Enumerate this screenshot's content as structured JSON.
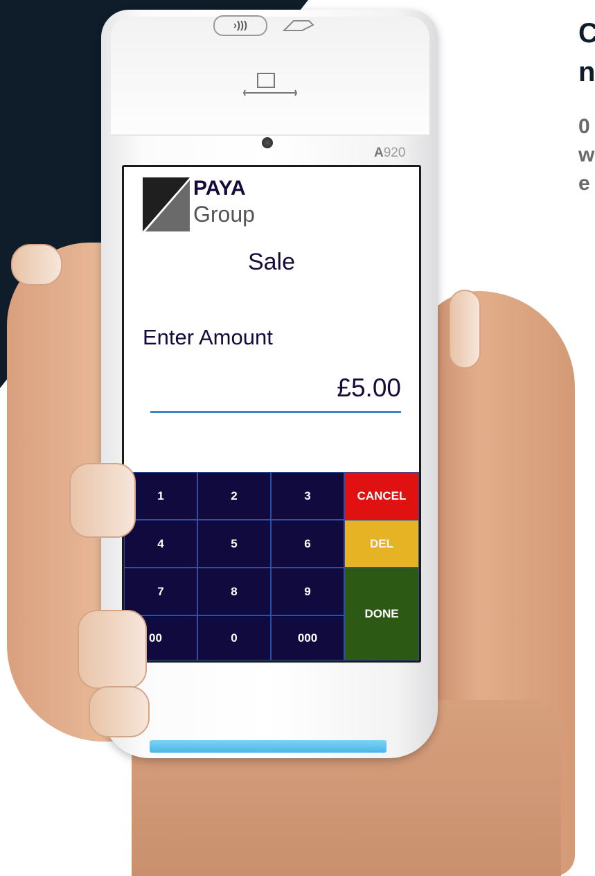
{
  "side_text": {
    "heading": "C\nn",
    "paragraph": "0\nw\ne"
  },
  "device": {
    "contactless_symbol": "›)))",
    "model_prefix": "A",
    "model_number": "920"
  },
  "screen": {
    "logo_line1": "PAYA",
    "logo_line2": "Group",
    "title": "Sale",
    "prompt": "Enter Amount",
    "amount": "£5.00"
  },
  "keypad": {
    "keys": [
      "1",
      "2",
      "3",
      "4",
      "5",
      "6",
      "7",
      "8",
      "9",
      "00",
      "0",
      "000"
    ],
    "cancel": "CANCEL",
    "del": "DEL",
    "done": "DONE"
  },
  "colors": {
    "dark_bg": "#0f1c29",
    "keypad_bg": "#100a3e",
    "cancel": "#e01111",
    "del": "#e6b325",
    "done": "#2c5a14",
    "underline": "#3a86c8"
  }
}
